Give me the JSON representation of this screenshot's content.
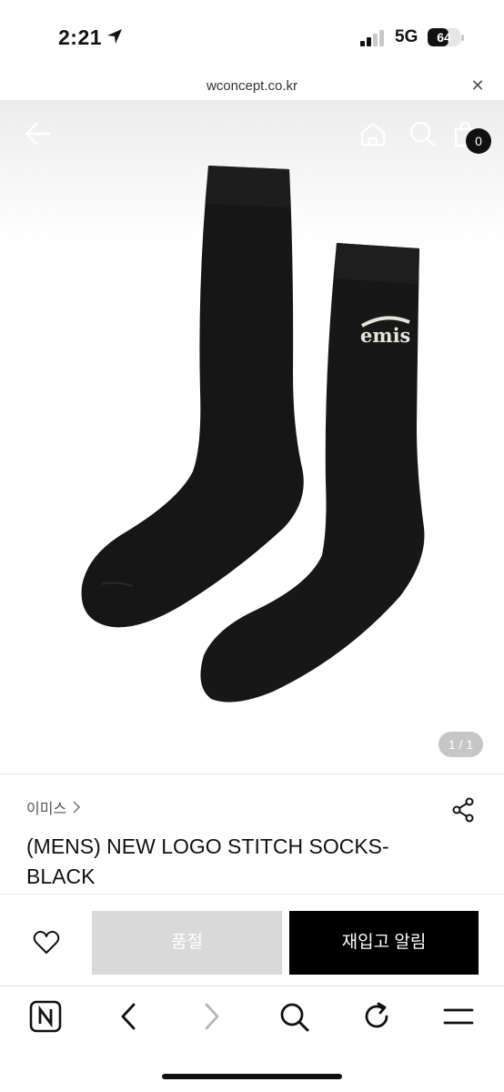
{
  "status_bar": {
    "time": "2:21",
    "network": "5G",
    "battery": "64",
    "battery_level": 0.64
  },
  "url_bar": {
    "domain": "wconcept.co.kr"
  },
  "top_nav": {
    "cart_count": "0"
  },
  "image_viewer": {
    "counter": "1 / 1",
    "logo_text": "emis"
  },
  "product": {
    "brand": "이미스",
    "title": "(MENS) NEW LOGO STITCH SOCKS-BLACK"
  },
  "action_bar": {
    "soldout_label": "품절",
    "restock_label": "재입고 알림"
  },
  "colors": {
    "primary_button": "#000000",
    "disabled_button": "#d9d9d9",
    "badge": "#111111"
  },
  "icons": [
    "back-arrow-icon",
    "home-icon",
    "search-icon",
    "shopping-bag-icon",
    "chevron-right-icon",
    "share-icon",
    "heart-icon",
    "naver-icon",
    "refresh-icon",
    "menu-icon"
  ]
}
